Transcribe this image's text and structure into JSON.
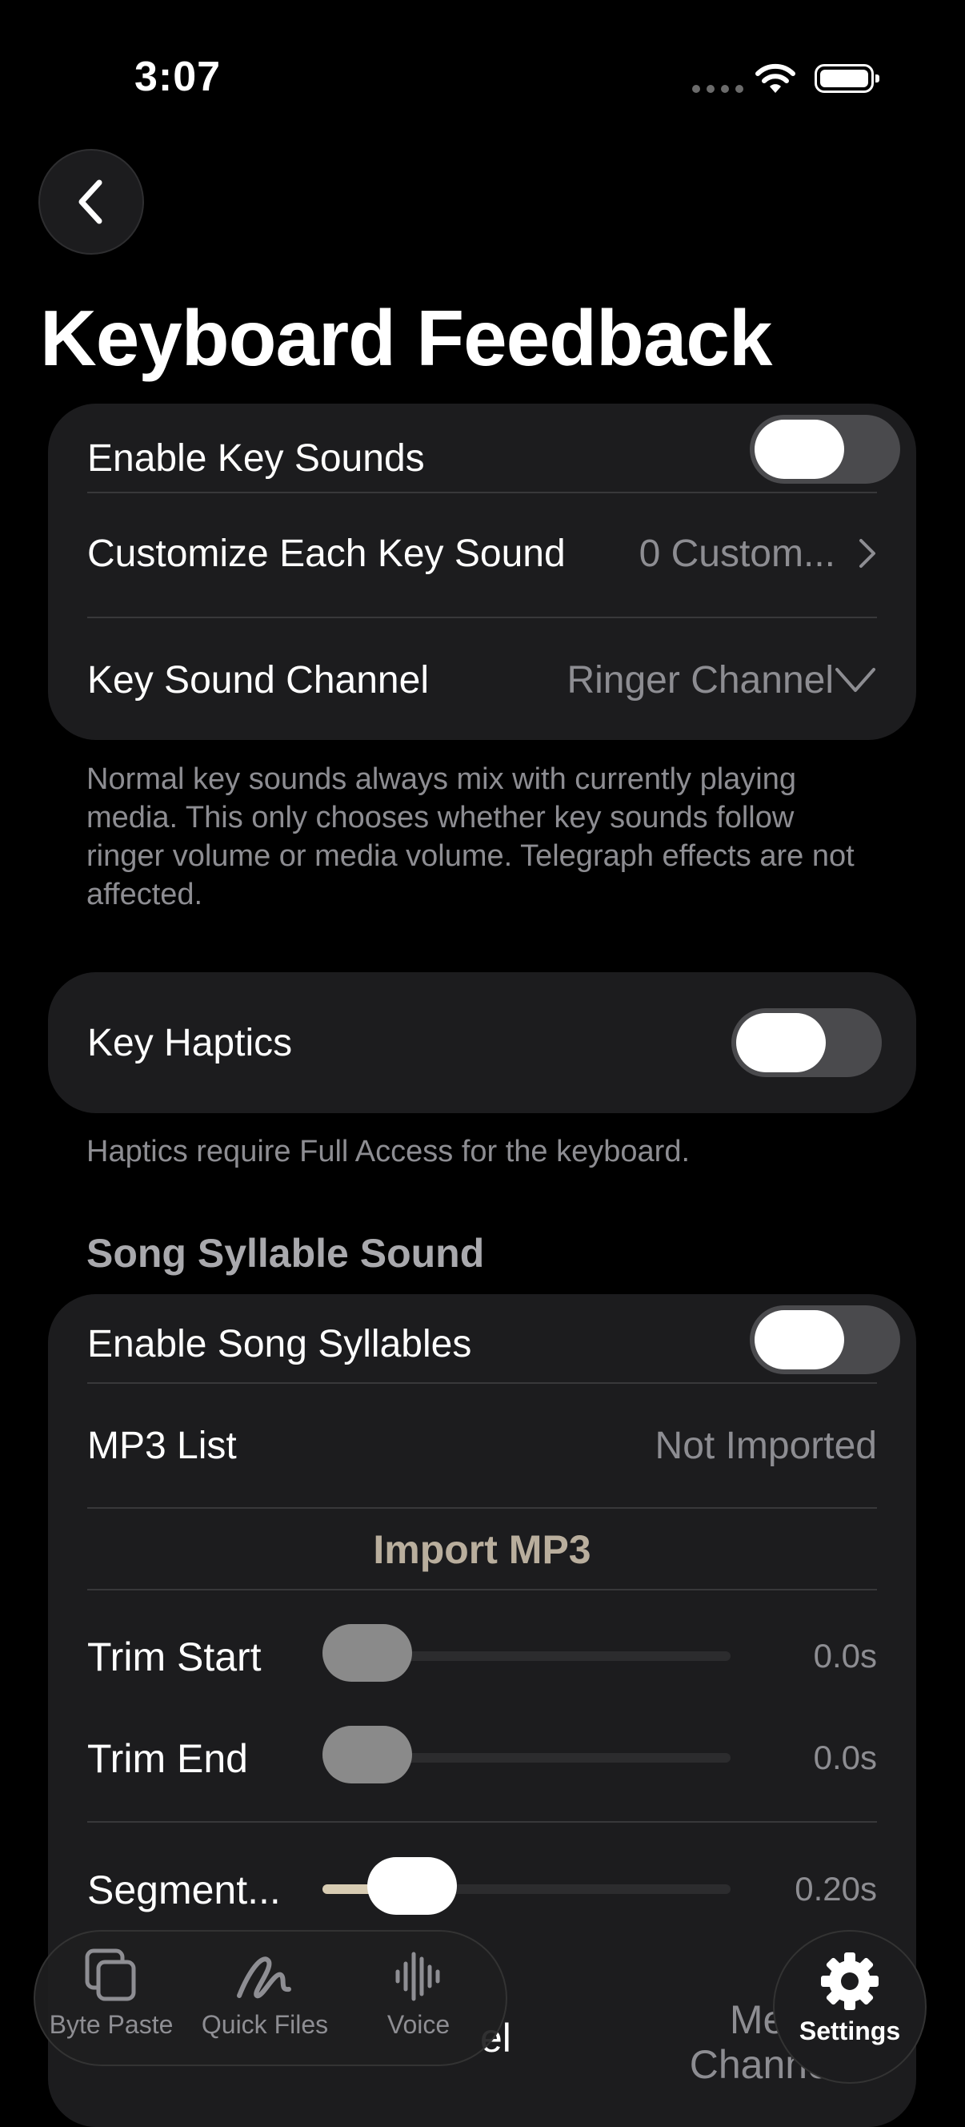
{
  "status_bar": {
    "time": "3:07"
  },
  "page": {
    "title": "Keyboard Feedback"
  },
  "sound_card": {
    "enable_key_sounds": "Enable Key Sounds",
    "customize_label": "Customize Each Key Sound",
    "customize_value": "0 Custom...",
    "channel_label": "Key Sound Channel",
    "channel_value": "Ringer Channel"
  },
  "sound_footer": "Normal key sounds always mix with currently playing media. This only chooses whether key sounds follow ringer volume or media volume. Telegraph effects are not affected.",
  "haptics_card": {
    "label": "Key Haptics"
  },
  "haptics_footer": "Haptics require Full Access for the keyboard.",
  "song_section": {
    "header": "Song Syllable Sound",
    "enable_label": "Enable Song Syllables",
    "mp3_label": "MP3 List",
    "mp3_value": "Not Imported",
    "import_label": "Import MP3",
    "trim_start_label": "Trim Start",
    "trim_start_value": "0.0s",
    "trim_start_fraction": 0,
    "trim_end_label": "Trim End",
    "trim_end_value": "0.0s",
    "trim_end_fraction": 0,
    "segment_label": "Segment...",
    "segment_value": "0.20s",
    "segment_fraction": 0.14,
    "partial_label": "el",
    "partial_value": "Media Channel"
  },
  "tabbar": {
    "tabs": [
      {
        "label": "Byte Paste",
        "icon": "copy-icon"
      },
      {
        "label": "Quick Files",
        "icon": "scribble-icon"
      },
      {
        "label": "Voice",
        "icon": "waveform-icon"
      }
    ],
    "settings": {
      "label": "Settings",
      "icon": "gear-icon"
    }
  },
  "colors": {
    "accent": "#d8ccb3",
    "card": "#1c1c1e",
    "secondary_text": "#8d8d92"
  }
}
